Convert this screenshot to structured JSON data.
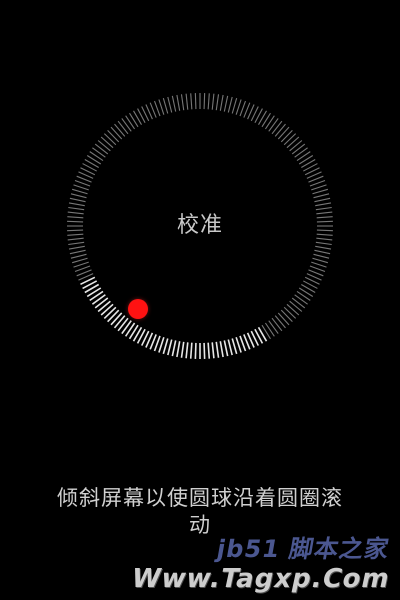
{
  "calibration": {
    "title": "校准",
    "instruction": "倾斜屏幕以使圆球沿着圆圈滚动",
    "progress_fraction": 0.23
  },
  "colors": {
    "background": "#000000",
    "tick_default": "#777777",
    "tick_completed": "#e6e6e6",
    "ball": "#ff1212"
  },
  "watermark": {
    "logo": "jb51 脚本之家",
    "url": "Www.Tagxp.Com"
  }
}
